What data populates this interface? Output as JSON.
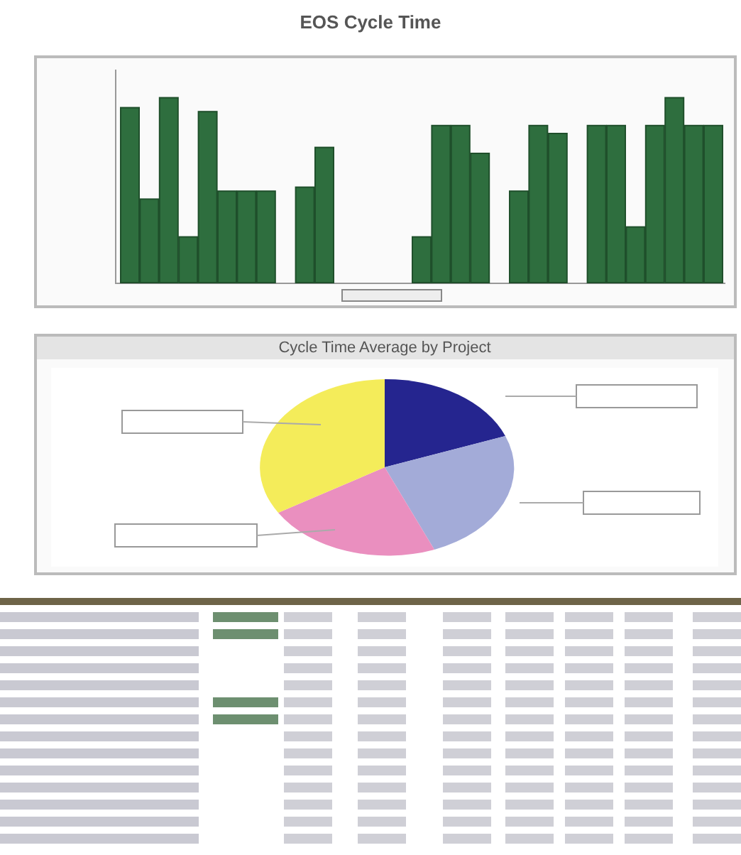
{
  "bar_chart": {
    "title": "EOS Cycle Time"
  },
  "pie_chart": {
    "title": "Cycle Time Average by Project"
  }
}
